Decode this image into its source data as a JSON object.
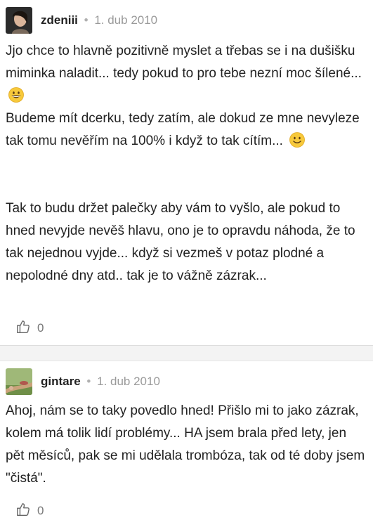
{
  "comments": [
    {
      "author": "zdeniii",
      "separator": "•",
      "date": "1. dub 2010",
      "paragraphs": [
        "Jjo chce to hlavně pozitivně myslet a třebas se i na dušišku miminka naladit... tedy pokud to pro tebe nezní moc šílené... ",
        "Budeme mít dcerku, tedy zatím, ale dokud ze mne nevyleze tak tomu nevěřím na 100% i když to tak cítím... ",
        "Tak to budu držet palečky aby vám to vyšlo, ale pokud to hned nevyjde nevěš hlavu, ono je to opravdu náhoda, že to tak nejednou vyjde... když si vezmeš v potaz plodné a nepolodné dny atd.. tak je to vážně zázrak..."
      ],
      "emojis": [
        "grinning-emoji",
        "smiling-emoji"
      ],
      "likes": "0"
    },
    {
      "author": "gintare",
      "separator": "•",
      "date": "1. dub 2010",
      "paragraphs": [
        "Ahoj, nám se to taky povedlo hned! Přišlo mi to jako zázrak, kolem má tolik lidí problémy... HA jsem brala před lety, jen pět měsíců, pak se mi udělala trombóza, tak od té doby jsem \"čistá\"."
      ],
      "likes": "0"
    }
  ],
  "colors": {
    "text": "#222222",
    "muted": "#9a9a9a",
    "divider": "#f3f3f3",
    "emoji": "#f7c93b"
  },
  "icons": [
    "thumbs-up-icon"
  ]
}
